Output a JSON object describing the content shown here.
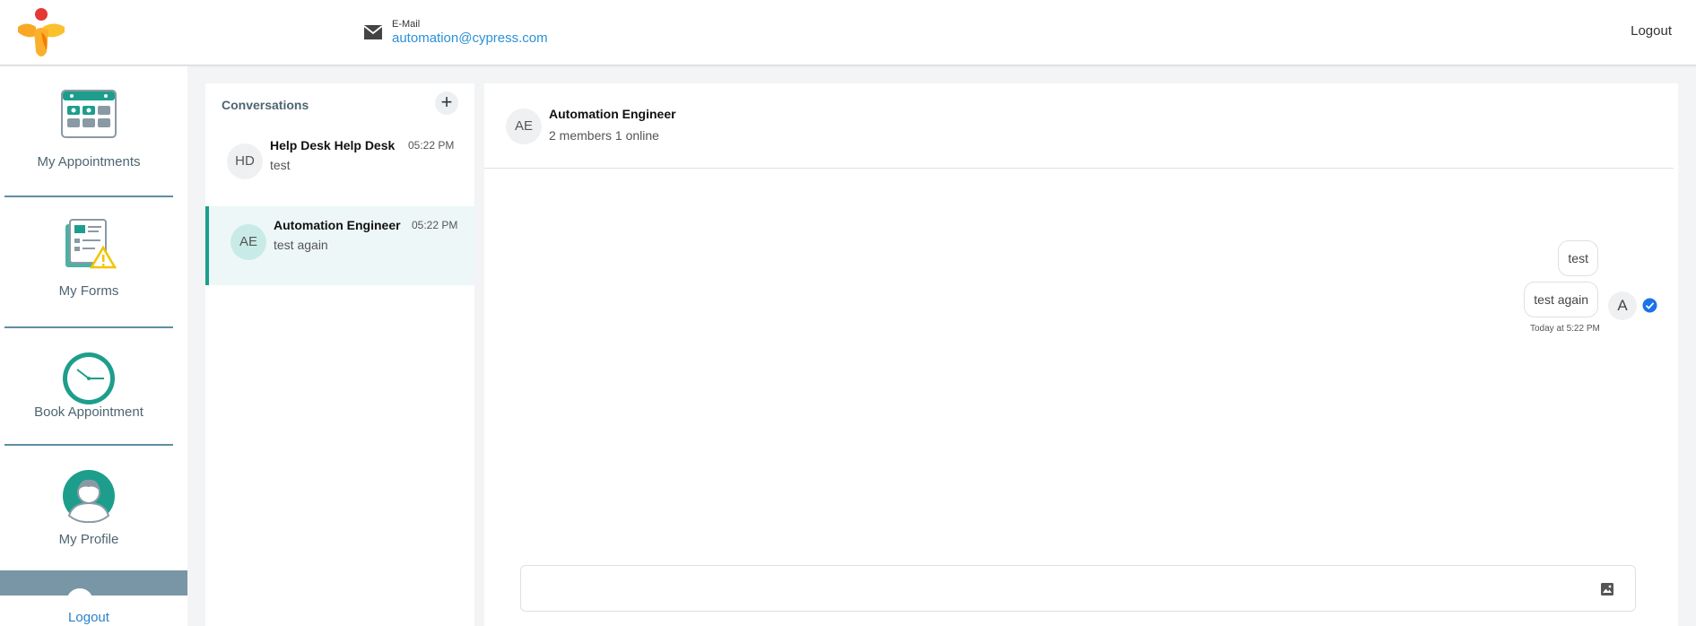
{
  "header": {
    "logo_icon": "app-logo",
    "email_icon": "envelope-icon",
    "email_label": "E-Mail",
    "email_value": "automation@cypress.com",
    "logout_label": "Logout"
  },
  "sidebar": {
    "items": [
      {
        "label": "My Appointments",
        "icon": "calendar-icon"
      },
      {
        "label": "My Forms",
        "icon": "forms-icon"
      },
      {
        "label": "Book Appointment",
        "icon": "clock-icon"
      },
      {
        "label": "My Profile",
        "icon": "profile-icon"
      }
    ],
    "logout_label": "Logout"
  },
  "conversations": {
    "title": "Conversations",
    "add_icon": "plus-icon",
    "items": [
      {
        "initials": "HD",
        "name": "Help Desk Help Desk",
        "time": "05:22 PM",
        "preview": "test",
        "active": false
      },
      {
        "initials": "AE",
        "name": "Automation Engineer",
        "time": "05:22 PM",
        "preview": "test again",
        "active": true
      }
    ]
  },
  "chat": {
    "initials": "AE",
    "title": "Automation Engineer",
    "subtitle": "2 members 1 online",
    "messages": [
      {
        "text": "test"
      },
      {
        "text": "test again"
      }
    ],
    "sender_initial": "A",
    "timestamp": "Today at 5:22 PM",
    "read_icon": "check-circle-icon",
    "composer_placeholder": "",
    "attach_icon": "image-icon"
  },
  "colors": {
    "accent": "#1d9e8c",
    "link": "#2a90d8",
    "sidebar_divider": "#5e8ea3",
    "check": "#1a73e8"
  }
}
